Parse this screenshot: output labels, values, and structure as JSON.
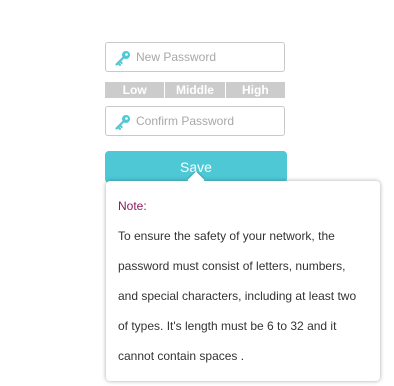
{
  "new_password": {
    "placeholder": "New Password",
    "value": ""
  },
  "strength_meter": {
    "levels": [
      "Low",
      "Middle",
      "High"
    ]
  },
  "confirm_password": {
    "placeholder": "Confirm Password",
    "value": ""
  },
  "save_button": {
    "label": "Save"
  },
  "tooltip": {
    "title": "Note:",
    "lines": [
      "To ensure the safety of your network, the",
      "password must consist of letters, numbers,",
      "and special characters, including at least two",
      "of types. It's length must be 6 to 32 and it",
      "cannot contain spaces ."
    ]
  },
  "colors": {
    "accent": "#4fc8d6",
    "key_icon": "#4fc8d6",
    "strength_bar": "#cccccc",
    "note_title": "#8b1a5e"
  },
  "icons": {
    "password_field": "key-icon"
  }
}
